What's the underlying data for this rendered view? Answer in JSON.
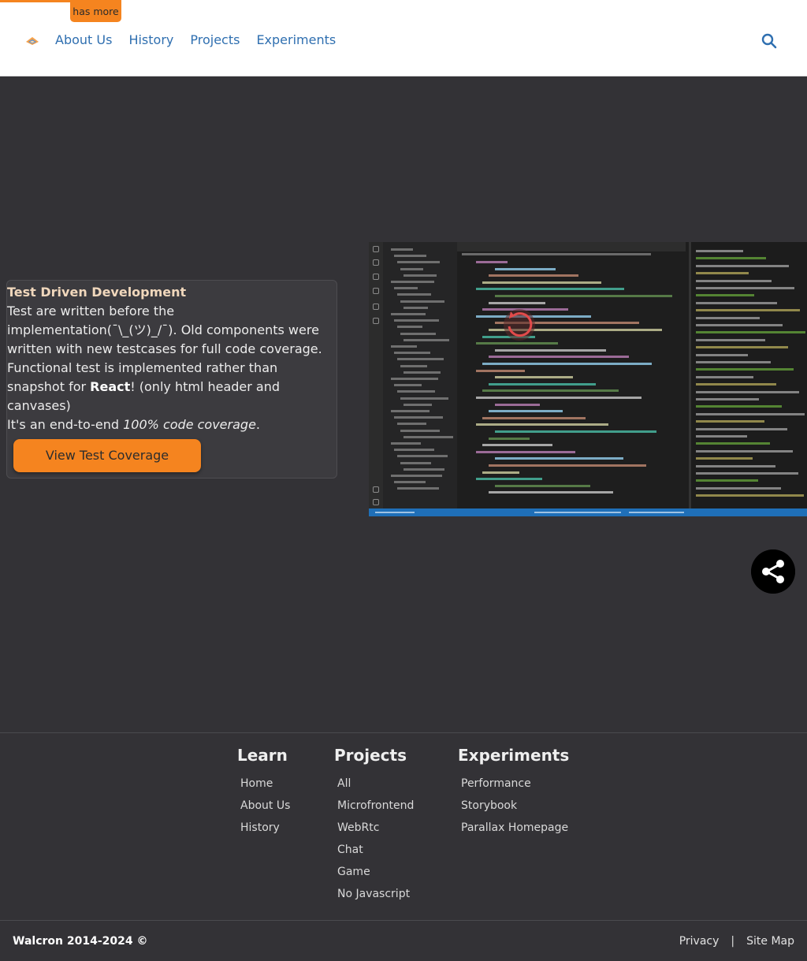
{
  "header": {
    "badge": "has more",
    "nav": [
      "About Us",
      "History",
      "Projects",
      "Experiments"
    ]
  },
  "main": {
    "title": "Test Driven Development",
    "p1": "Test are written before the implementation(¯\\_(ツ)_/¯). Old components were written with new testcases for full code coverage.",
    "p2a": "Functional test is implemented rather than snapshot for ",
    "p2b": "React",
    "p2c": "! (only html header and canvases)",
    "p3a": "It's an end-to-end ",
    "p3b": "100% code coverage",
    "p3c": ".",
    "button": "View Test Coverage"
  },
  "footer": {
    "learn": {
      "title": "Learn",
      "links": [
        "Home",
        "About Us",
        "History"
      ]
    },
    "projects": {
      "title": "Projects",
      "links": [
        "All",
        "Microfrontend",
        "WebRtc",
        "Chat",
        "Game",
        "No Javascript"
      ]
    },
    "experiments": {
      "title": "Experiments",
      "links": [
        "Performance",
        "Storybook",
        "Parallax Homepage"
      ]
    },
    "copyright": "Walcron 2014-2024 ©",
    "privacy": "Privacy",
    "separator": "|",
    "sitemap": "Site Map"
  },
  "icons": [
    "logo-icon",
    "search-icon",
    "share-icon",
    "refresh-icon"
  ],
  "colors": {
    "accent": "#f5841f",
    "link": "#2f6fb0",
    "background": "#333236"
  }
}
